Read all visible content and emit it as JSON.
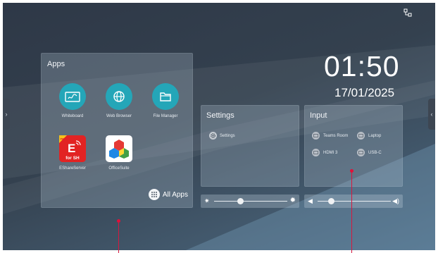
{
  "apps_panel": {
    "title": "Apps",
    "apps": [
      {
        "label": "Whiteboard",
        "icon": "whiteboard-icon"
      },
      {
        "label": "Web Browser",
        "icon": "globe-icon"
      },
      {
        "label": "File Manager",
        "icon": "folder-icon"
      },
      {
        "label": "EShareServer",
        "icon": "eshare-icon",
        "badge": "for SH",
        "badge_tag": "PRO"
      },
      {
        "label": "OfficeSuite",
        "icon": "officesuite-icon"
      }
    ],
    "all_apps_label": "All Apps"
  },
  "clock": {
    "time": "01:50",
    "date": "17/01/2025"
  },
  "settings_panel": {
    "title": "Settings",
    "items": [
      {
        "label": "Settings",
        "icon": "gear-icon"
      }
    ]
  },
  "input_panel": {
    "title": "Input",
    "sources": [
      {
        "label": "Teams Room"
      },
      {
        "label": "Laptop"
      },
      {
        "label": "HDMI 3"
      },
      {
        "label": "USB-C"
      }
    ]
  },
  "brightness": {
    "level": 0.36,
    "icon_low": "brightness-low-icon",
    "icon_high": "brightness-high-icon"
  },
  "volume": {
    "level": 0.18,
    "icon_low": "volume-low-icon",
    "icon_high": "volume-high-icon"
  },
  "colors": {
    "accent": "#24a6b8",
    "marker": "#d6183f"
  }
}
